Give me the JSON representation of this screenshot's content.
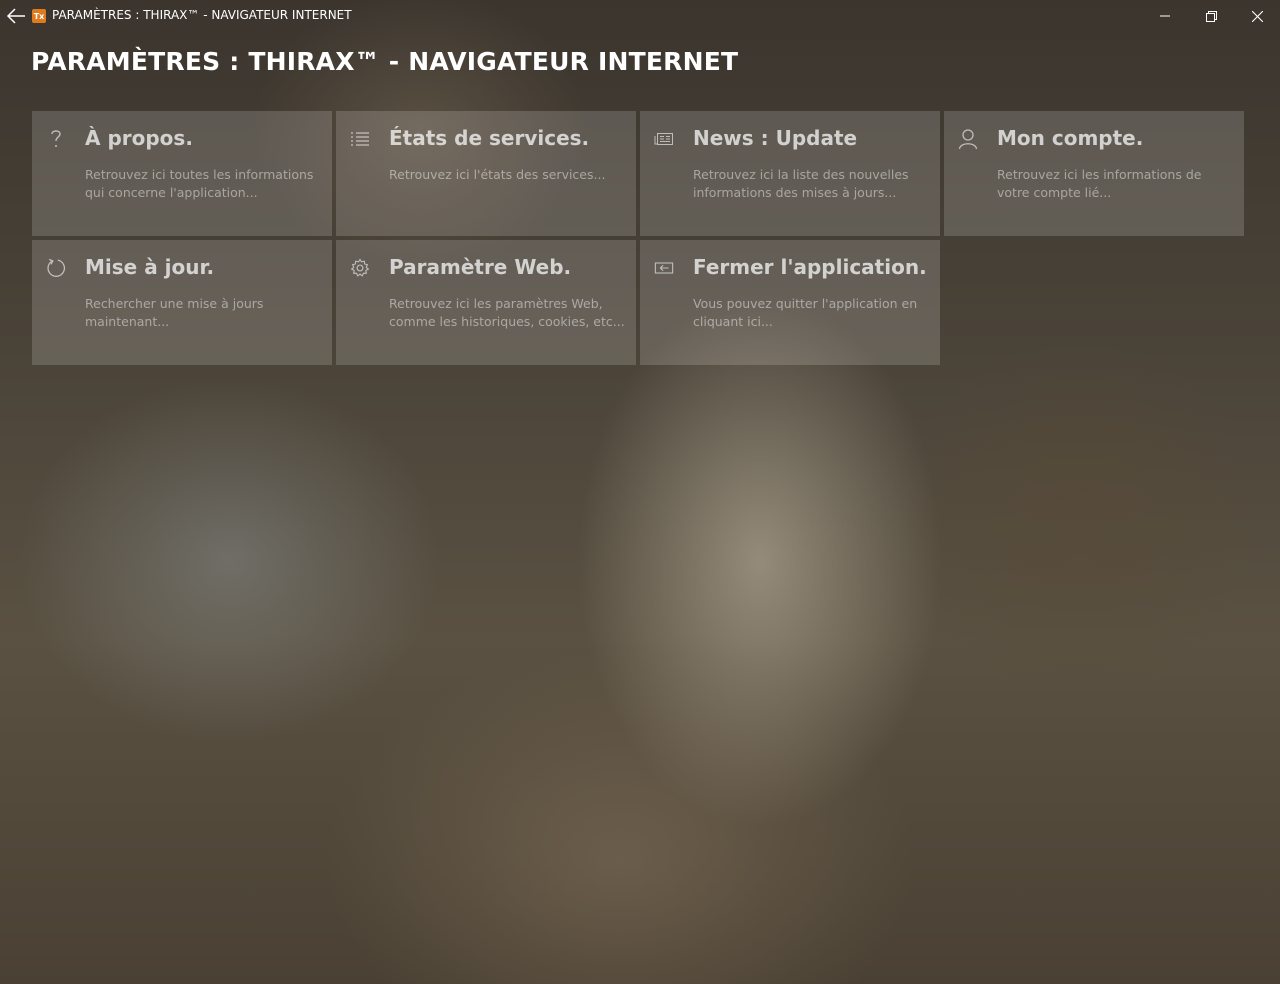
{
  "window": {
    "title": "PARAMÈTRES : THIRAX™ - NAVIGATEUR INTERNET",
    "app_icon_text": "Tx"
  },
  "page": {
    "title": "PARAMÈTRES : THIRAX™ - NAVIGATEUR INTERNET"
  },
  "tiles": [
    {
      "icon": "question-mark-icon",
      "title": "À propos.",
      "desc": "Retrouvez ici toutes les informations qui concerne l'application..."
    },
    {
      "icon": "list-icon",
      "title": "États de services.",
      "desc": "Retrouvez ici l'états des services..."
    },
    {
      "icon": "news-icon",
      "title": "News : Update",
      "desc": "Retrouvez ici la liste des nouvelles informations des mises à jours..."
    },
    {
      "icon": "person-icon",
      "title": "Mon compte.",
      "desc": "Retrouvez ici les informations de votre compte lié..."
    },
    {
      "icon": "refresh-icon",
      "title": "Mise à jour.",
      "desc": "Rechercher une mise à jours maintenant..."
    },
    {
      "icon": "gear-icon",
      "title": "Paramètre Web.",
      "desc": "Retrouvez ici les paramètres Web, comme les historiques, cookies, etc..."
    },
    {
      "icon": "exit-icon",
      "title": "Fermer l'application.",
      "desc": "Vous pouvez quitter l'application en cliquant ici..."
    }
  ]
}
